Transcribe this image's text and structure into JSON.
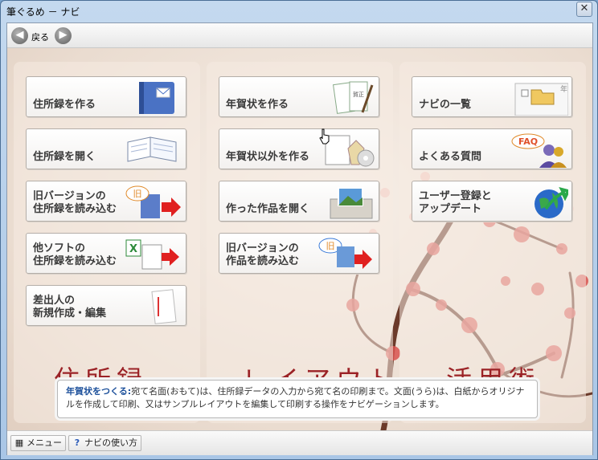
{
  "window": {
    "title": "筆ぐるめ － ナビ",
    "close_glyph": "✕"
  },
  "toolbar": {
    "back_label": "戻る",
    "back_glyph": "◀",
    "forward_glyph": "▶"
  },
  "columns": [
    {
      "category": "住所録",
      "items": [
        {
          "label": "住所録を作る"
        },
        {
          "label": "住所録を開く"
        },
        {
          "label": "旧バージョンの\n住所録を読み込む",
          "badge": "旧"
        },
        {
          "label": "他ソフトの\n住所録を読み込む"
        },
        {
          "label": "差出人の\n新規作成・編集"
        }
      ]
    },
    {
      "category": "レイアウト",
      "items": [
        {
          "label": "年賀状を作る",
          "badge": "賀正"
        },
        {
          "label": "年賀状以外を作る"
        },
        {
          "label": "作った作品を開く"
        },
        {
          "label": "旧バージョンの\n作品を読み込む",
          "badge": "旧"
        }
      ]
    },
    {
      "category": "活用術",
      "items": [
        {
          "label": "ナビの一覧",
          "badge": "年賀"
        },
        {
          "label": "よくある質問",
          "badge": "FAQ"
        },
        {
          "label": "ユーザー登録と\nアップデート"
        }
      ]
    }
  ],
  "description": {
    "heading": "年賀状をつくる:",
    "text": "宛て名面(おもて)は、住所録データの入力から宛て名の印刷まで。文面(うら)は、白紙からオリジナルを作成して印刷、又はサンプルレイアウトを編集して印刷する操作をナビゲーションします。"
  },
  "bottombar": {
    "menu_label": "メニュー",
    "help_label": "ナビの使い方",
    "help_glyph": "?"
  },
  "colors": {
    "accent_red": "#9b2226",
    "link_blue": "#1b4f9a"
  }
}
